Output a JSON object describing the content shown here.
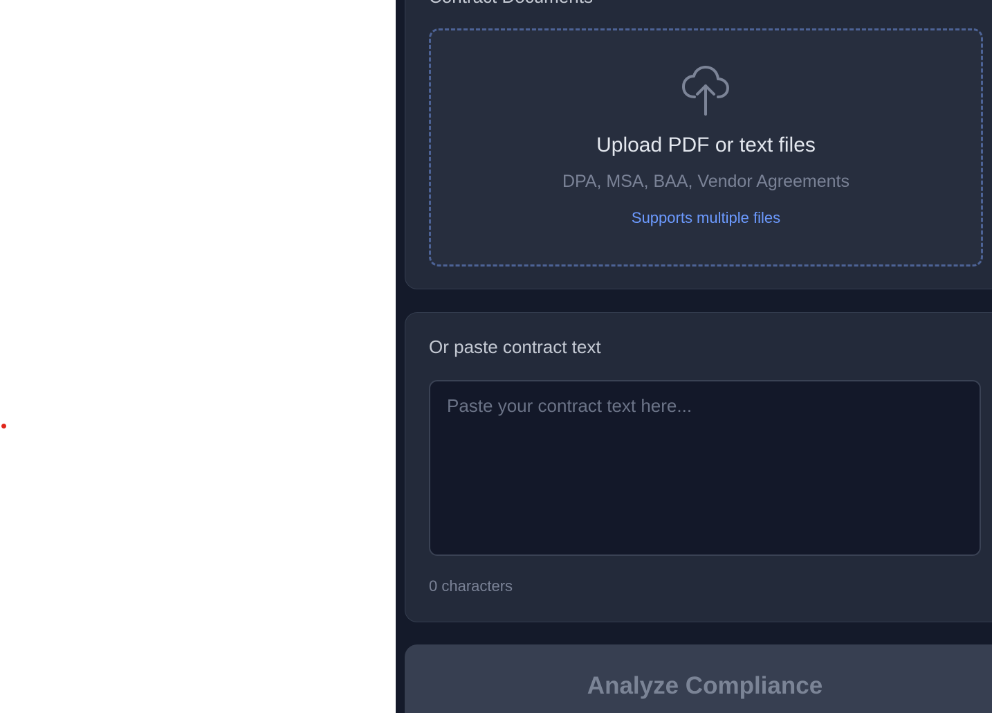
{
  "documents": {
    "section_title": "Contract Documents",
    "upload_main": "Upload PDF or text files",
    "upload_types": "DPA, MSA, BAA, Vendor Agreements",
    "upload_note": "Supports multiple files",
    "icon": "cloud-upload-icon"
  },
  "paste": {
    "section_title": "Or paste contract text",
    "placeholder": "Paste your contract text here...",
    "value": "",
    "char_count": "0 characters"
  },
  "actions": {
    "analyze_label": "Analyze Compliance",
    "analyze_enabled": false
  },
  "colors": {
    "panel_background": "#141a2a",
    "card_background": "#232a3a",
    "dropzone_border": "#4d6396",
    "accent_link": "#6c9aff",
    "disabled_button": "#373f51",
    "marker_dot": "#e0261b"
  }
}
